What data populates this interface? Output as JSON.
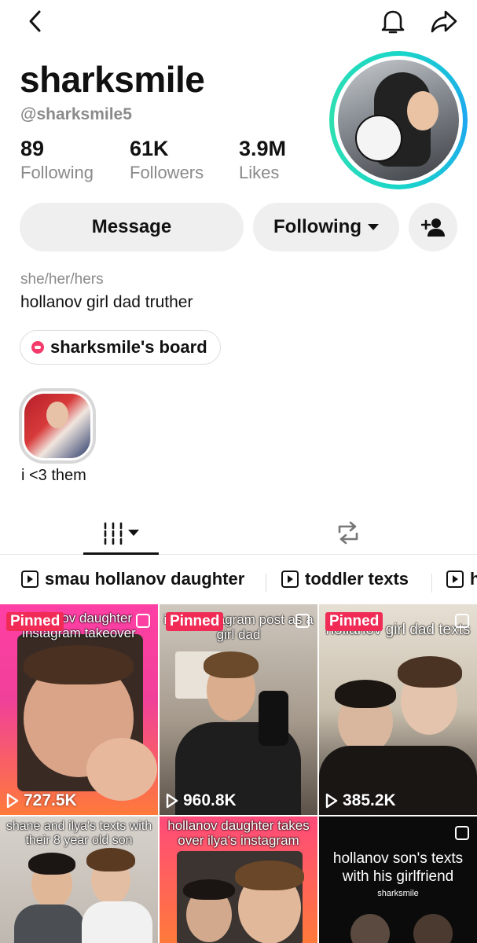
{
  "profile": {
    "username": "sharksmile",
    "handle": "@sharksmile5",
    "pronouns": "she/her/hers",
    "bio": "hollanov girl dad truther",
    "stats": [
      {
        "value": "89",
        "label": "Following"
      },
      {
        "value": "61K",
        "label": "Followers"
      },
      {
        "value": "3.9M",
        "label": "Likes"
      }
    ]
  },
  "icons": {
    "back": "chevron-left-icon",
    "bell": "bell-icon",
    "share": "share-arrow-icon",
    "add_user": "add-user-icon",
    "grid": "grid-icon",
    "repost": "repost-icon",
    "playlist": "playlist-play-icon",
    "views": "play-icon"
  },
  "colors": {
    "accent": "#f02c56",
    "ring": "#1ea7f0",
    "muted_text": "#8a8a8a",
    "button_bg": "#efefef"
  },
  "actions": {
    "message_label": "Message",
    "following_label": "Following"
  },
  "board": {
    "label": "sharksmile's board"
  },
  "highlight": {
    "label": "i <3 them"
  },
  "playlists": [
    {
      "label": "smau hollanov daughter"
    },
    {
      "label": "toddler texts"
    },
    {
      "label": "h"
    }
  ],
  "videos": [
    {
      "pinned": "Pinned",
      "caption": "hollanov daughter instagram takeover",
      "views": "727.5K"
    },
    {
      "pinned": "Pinned",
      "caption": "ilya's instagram post as a girl dad",
      "views": "960.8K"
    },
    {
      "pinned": "Pinned",
      "caption": "hollanov girl dad texts",
      "views": "385.2K"
    },
    {
      "caption": "shane and ilya's texts with their 8 year old son"
    },
    {
      "caption": "hollanov daughter takes over ilya's instagram"
    },
    {
      "caption": "hollanov son's texts with his girlfriend",
      "sub": "sharksmile"
    }
  ]
}
